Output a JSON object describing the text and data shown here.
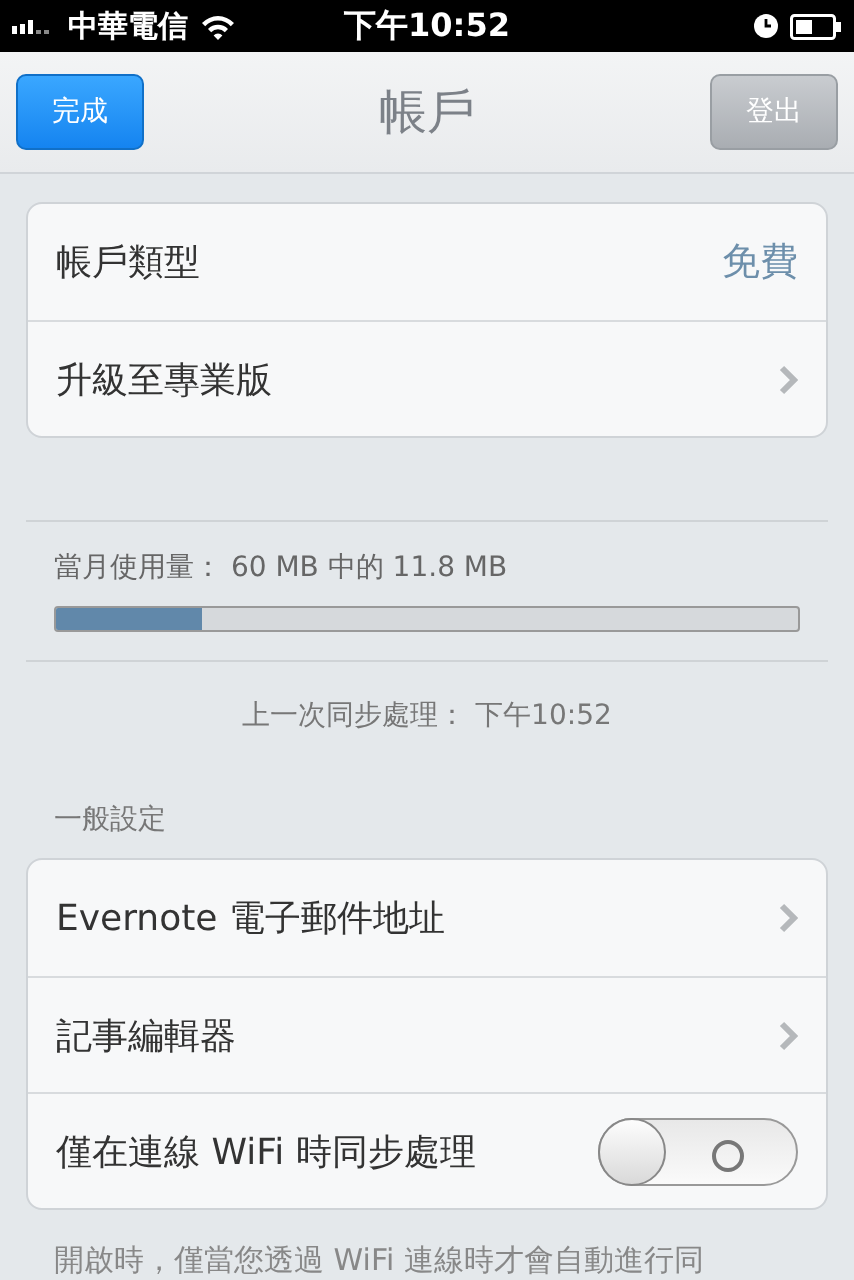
{
  "status_bar": {
    "carrier": "中華電信",
    "time": "下午10:52"
  },
  "nav_bar": {
    "title": "帳戶",
    "left_button": "完成",
    "right_button": "登出"
  },
  "account_rows": [
    {
      "kind": "value",
      "label": "帳戶類型",
      "value": "免費"
    },
    {
      "kind": "link",
      "label": "升級至專業版"
    }
  ],
  "usage": {
    "text": "當月使用量： 60 MB 中的 11.8 MB",
    "level": 0.197
  },
  "last_sync": "上一次同步處理： 下午10:52",
  "general_section": {
    "header": "一般設定",
    "rows": [
      {
        "kind": "link",
        "label": "Evernote 電子郵件地址"
      },
      {
        "kind": "link",
        "label": "記事編輯器"
      },
      {
        "kind": "toggle",
        "label": "僅在連線 WiFi 時同步處理",
        "on": false
      }
    ],
    "footer": "開啟時，僅當您透過 WiFi 連線時才會自動進行同"
  }
}
